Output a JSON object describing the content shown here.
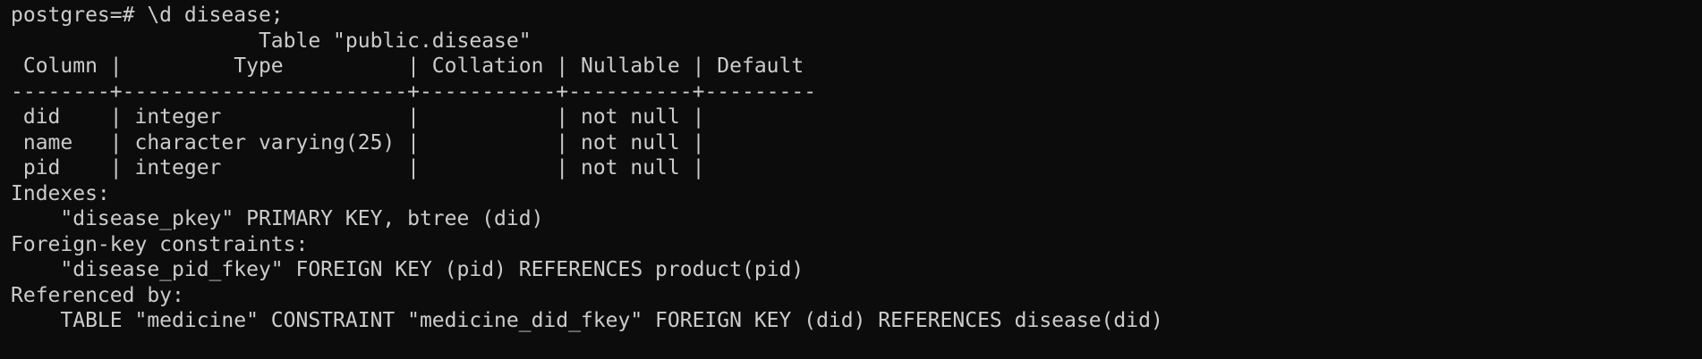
{
  "terminal": {
    "colors": {
      "background": "#0c0c0c",
      "foreground": "#cccccc"
    },
    "lines": [
      "postgres=# \\d disease;",
      "                    Table \"public.disease\"",
      " Column |         Type          | Collation | Nullable | Default",
      "--------+-----------------------+-----------+----------+---------",
      " did    | integer               |           | not null |",
      " name   | character varying(25) |           | not null |",
      " pid    | integer               |           | not null |",
      "Indexes:",
      "    \"disease_pkey\" PRIMARY KEY, btree (did)",
      "Foreign-key constraints:",
      "    \"disease_pid_fkey\" FOREIGN KEY (pid) REFERENCES product(pid)",
      "Referenced by:",
      "    TABLE \"medicine\" CONSTRAINT \"medicine_did_fkey\" FOREIGN KEY (did) REFERENCES disease(did)"
    ]
  }
}
